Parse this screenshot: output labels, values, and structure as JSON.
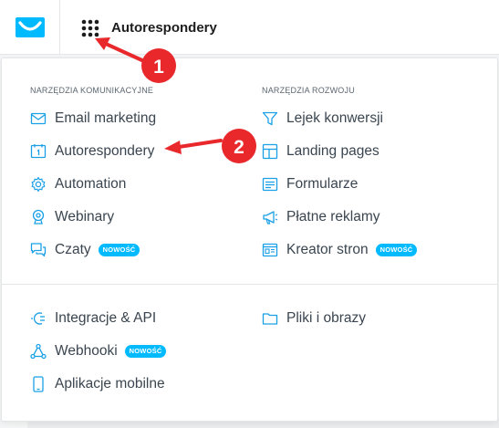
{
  "header": {
    "app_title": "Autorespondery"
  },
  "menu": {
    "left_section_title": "NARZĘDZIA KOMUNIKACYJNE",
    "right_section_title": "NARZĘDZIA ROZWOJU",
    "left_items": [
      {
        "label": "Email marketing",
        "icon": "envelope-icon"
      },
      {
        "label": "Autorespondery",
        "icon": "calendar-icon"
      },
      {
        "label": "Automation",
        "icon": "gear-icon"
      },
      {
        "label": "Webinary",
        "icon": "webcam-icon"
      },
      {
        "label": "Czaty",
        "icon": "chat-icon",
        "badge": "NOWOŚĆ"
      }
    ],
    "right_items": [
      {
        "label": "Lejek konwersji",
        "icon": "funnel-icon"
      },
      {
        "label": "Landing pages",
        "icon": "layout-icon"
      },
      {
        "label": "Formularze",
        "icon": "form-icon"
      },
      {
        "label": "Płatne reklamy",
        "icon": "megaphone-icon"
      },
      {
        "label": "Kreator stron",
        "icon": "website-icon",
        "badge": "NOWOŚĆ"
      }
    ],
    "bottom_left_items": [
      {
        "label": "Integracje & API",
        "icon": "plug-icon"
      },
      {
        "label": "Webhooki",
        "icon": "webhook-icon",
        "badge": "NOWOŚĆ"
      },
      {
        "label": "Aplikacje mobilne",
        "icon": "smartphone-icon"
      }
    ],
    "bottom_right_items": [
      {
        "label": "Pliki i obrazy",
        "icon": "folder-icon"
      }
    ]
  },
  "annotations": {
    "marker_1": "1",
    "marker_2": "2"
  },
  "colors": {
    "accent": "#00baff",
    "icon": "#1aa0e6",
    "text": "#3a4550",
    "marker": "#e8282b"
  }
}
